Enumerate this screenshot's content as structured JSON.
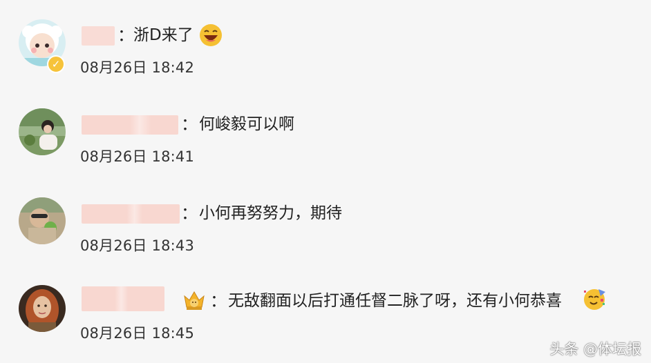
{
  "comments": [
    {
      "text": "浙D来了",
      "time": "08月26日 18:42",
      "emoji": "laughing-emoji",
      "verified": true
    },
    {
      "text": "何峻毅可以啊",
      "time": "08月26日 18:41",
      "emoji": null,
      "verified": false
    },
    {
      "text": "小何再努努力，期待",
      "time": "08月26日 18:43",
      "emoji": null,
      "verified": false
    },
    {
      "text": "无敌翻面以后打通任督二脉了呀，还有小何恭喜",
      "time": "08月26日 18:45",
      "emoji": "party-emoji",
      "verified": false,
      "badge": "crown-emoji"
    }
  ],
  "colon": "：",
  "verified_mark": "✓",
  "watermark": "头条 @体坛报",
  "colors": {
    "background": "#f6f6f6",
    "username_mask": "#f8d9d2",
    "verified": "#f6c33a",
    "text": "#222222"
  }
}
